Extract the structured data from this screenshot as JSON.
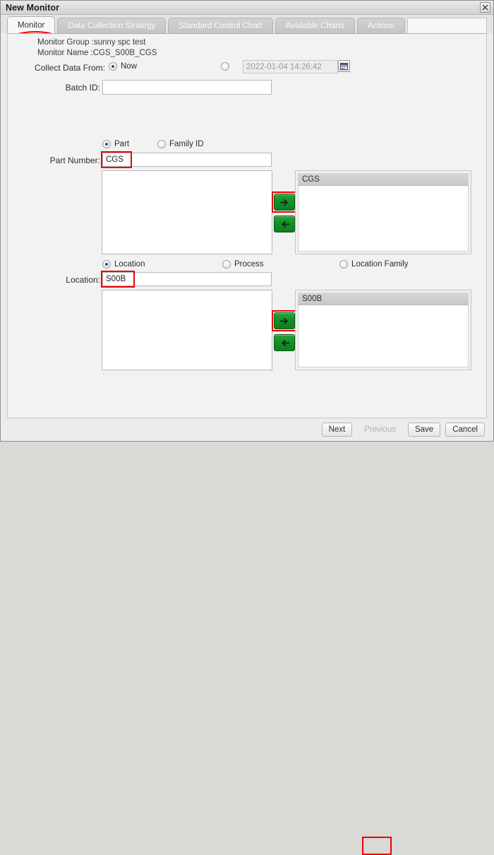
{
  "window": {
    "title": "New Monitor",
    "close_icon": "close-icon"
  },
  "tabs": [
    {
      "label": "Monitor",
      "active": true
    },
    {
      "label": "Data Collection Strategy",
      "active": false
    },
    {
      "label": "Standard Control Chart",
      "active": false
    },
    {
      "label": "Available Charts",
      "active": false
    },
    {
      "label": "Actions",
      "active": false
    }
  ],
  "header": {
    "monitor_group": "Monitor Group :sunny spc test",
    "monitor_name": "Monitor Name :CGS_S00B_CGS"
  },
  "collect_data": {
    "label": "Collect Data From:",
    "now_label": "Now",
    "now_selected": true,
    "date_selected": false,
    "date_value": "2022-01-04 14:26:42",
    "calendar_icon": "calendar-icon"
  },
  "batch": {
    "label": "Batch ID:",
    "value": "",
    "placeholder": ""
  },
  "part_section": {
    "radio_part": "Part",
    "radio_family_id": "Family ID",
    "part_selected": true,
    "family_selected": false,
    "number_label": "Part Number:",
    "number_value": "CGS",
    "selected_header": "CGS",
    "add_icon": "arrow-right-icon",
    "remove_icon": "arrow-left-icon"
  },
  "location_section": {
    "radio_location": "Location",
    "radio_process": "Process",
    "radio_location_family": "Location Family",
    "location_selected": true,
    "process_selected": false,
    "location_family_selected": false,
    "location_label": "Location:",
    "location_value": "S00B",
    "selected_header": "S00B",
    "add_icon": "arrow-right-icon",
    "remove_icon": "arrow-left-icon"
  },
  "footer": {
    "next": "Next",
    "previous": "Previous",
    "save": "Save",
    "cancel": "Cancel",
    "previous_disabled": true
  },
  "colors": {
    "annotation_red": "#ee0000",
    "transfer_green": "#149028",
    "window_bg": "#ececec",
    "panel_bg": "#f2f2f2"
  }
}
